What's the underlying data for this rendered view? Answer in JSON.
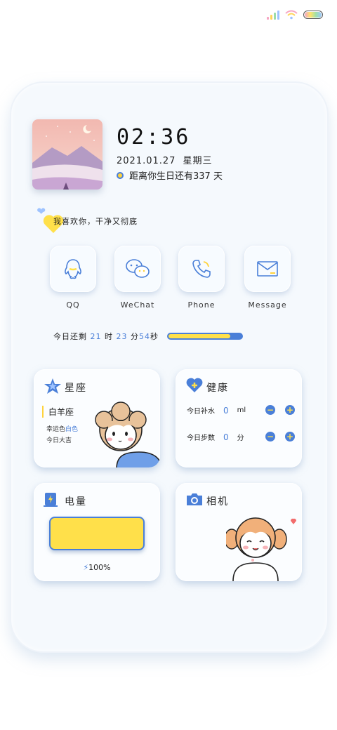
{
  "clock": {
    "time": "02:36",
    "date": "2021.01.27",
    "weekday": "星期三"
  },
  "birthday": {
    "text": "距离你生日还有337 天"
  },
  "quote": {
    "text": "我喜欢你，干净又彻底"
  },
  "apps": [
    {
      "label": "QQ",
      "icon": "qq-penguin-icon"
    },
    {
      "label": "WeChat",
      "icon": "wechat-chat-icon"
    },
    {
      "label": "Phone",
      "icon": "phone-handset-icon"
    },
    {
      "label": "Message",
      "icon": "envelope-icon"
    }
  ],
  "countdown": {
    "prefix": "今日还剩",
    "hours": "21",
    "hours_unit": "时",
    "minutes": "23",
    "minutes_unit": "分",
    "seconds": "54",
    "seconds_unit": "秒",
    "progress_fraction": 0.85
  },
  "zodiac": {
    "title": "星座",
    "sign": "白羊座",
    "lucky_color_label": "幸运色",
    "lucky_color": "白色",
    "fortune": "今日大吉"
  },
  "health": {
    "title": "健康",
    "water_label": "今日补水",
    "water_value": "0",
    "water_unit": "ml",
    "steps_label": "今日步数",
    "steps_value": "0",
    "steps_unit": "分"
  },
  "battery_widget": {
    "title": "电量",
    "percent": "100%"
  },
  "camera": {
    "title": "相机"
  },
  "colors": {
    "accent_blue": "#4a7fd8",
    "accent_yellow": "#ffe04a",
    "background": "#f5f9fd"
  }
}
